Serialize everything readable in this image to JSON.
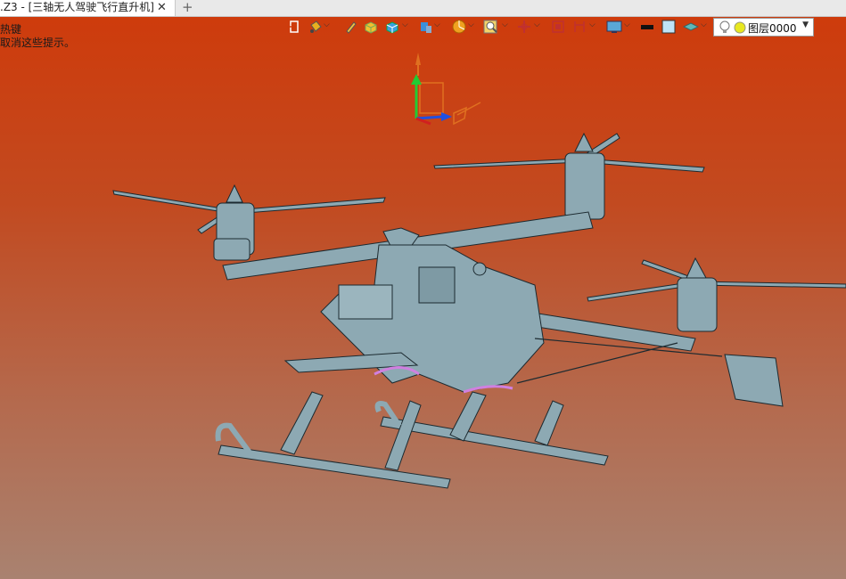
{
  "window": {
    "tab_title": ".Z3 - [三轴无人驾驶飞行直升机]",
    "tab_close": "✕",
    "tab_add": "+"
  },
  "hints": [
    "热键",
    "取消这些提示。"
  ],
  "toolbar": {
    "icons": [
      "insert-icon",
      "paint-bucket-icon",
      "pen-icon",
      "box-color-icon",
      "cube-icon",
      "view-icon",
      "pie-icon",
      "zoom-icon",
      "orbit-icon",
      "frame-icon",
      "align-icon",
      "display-icon",
      "line-color-icon",
      "face-color-icon",
      "layer-icon"
    ]
  },
  "layer_selector": {
    "value": "图层0000"
  },
  "colors": {
    "background_top": "#cf3a0a",
    "background_bottom": "#a98270",
    "model": "#8da9b3",
    "model_edge": "#1c2a30"
  }
}
